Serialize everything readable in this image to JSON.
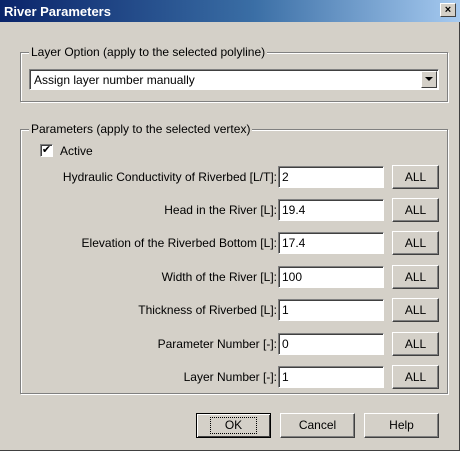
{
  "window": {
    "title": "River Parameters",
    "close_glyph": "×"
  },
  "layer_option": {
    "legend": "Layer Option (apply to the selected polyline)",
    "selected": "Assign layer number manually"
  },
  "parameters": {
    "legend": "Parameters (apply to the selected vertex)",
    "active_label": "Active",
    "active_checked": true,
    "check_glyph": "✔",
    "all_label": "ALL",
    "fields": [
      {
        "label": "Hydraulic Conductivity of Riverbed [L/T]:",
        "value": "2"
      },
      {
        "label": "Head in the River [L]:",
        "value": "19.4"
      },
      {
        "label": "Elevation of the Riverbed Bottom [L]:",
        "value": "17.4"
      },
      {
        "label": "Width of the River [L]:",
        "value": "100"
      },
      {
        "label": "Thickness of Riverbed [L]:",
        "value": "1"
      },
      {
        "label": "Parameter Number [-]:",
        "value": "0"
      },
      {
        "label": "Layer Number [-]:",
        "value": "1"
      }
    ]
  },
  "buttons": {
    "ok": "OK",
    "cancel": "Cancel",
    "help": "Help"
  },
  "colors": {
    "titlebar_start": "#0a246a",
    "titlebar_end": "#a6caf0",
    "face": "#d4d0c8"
  }
}
